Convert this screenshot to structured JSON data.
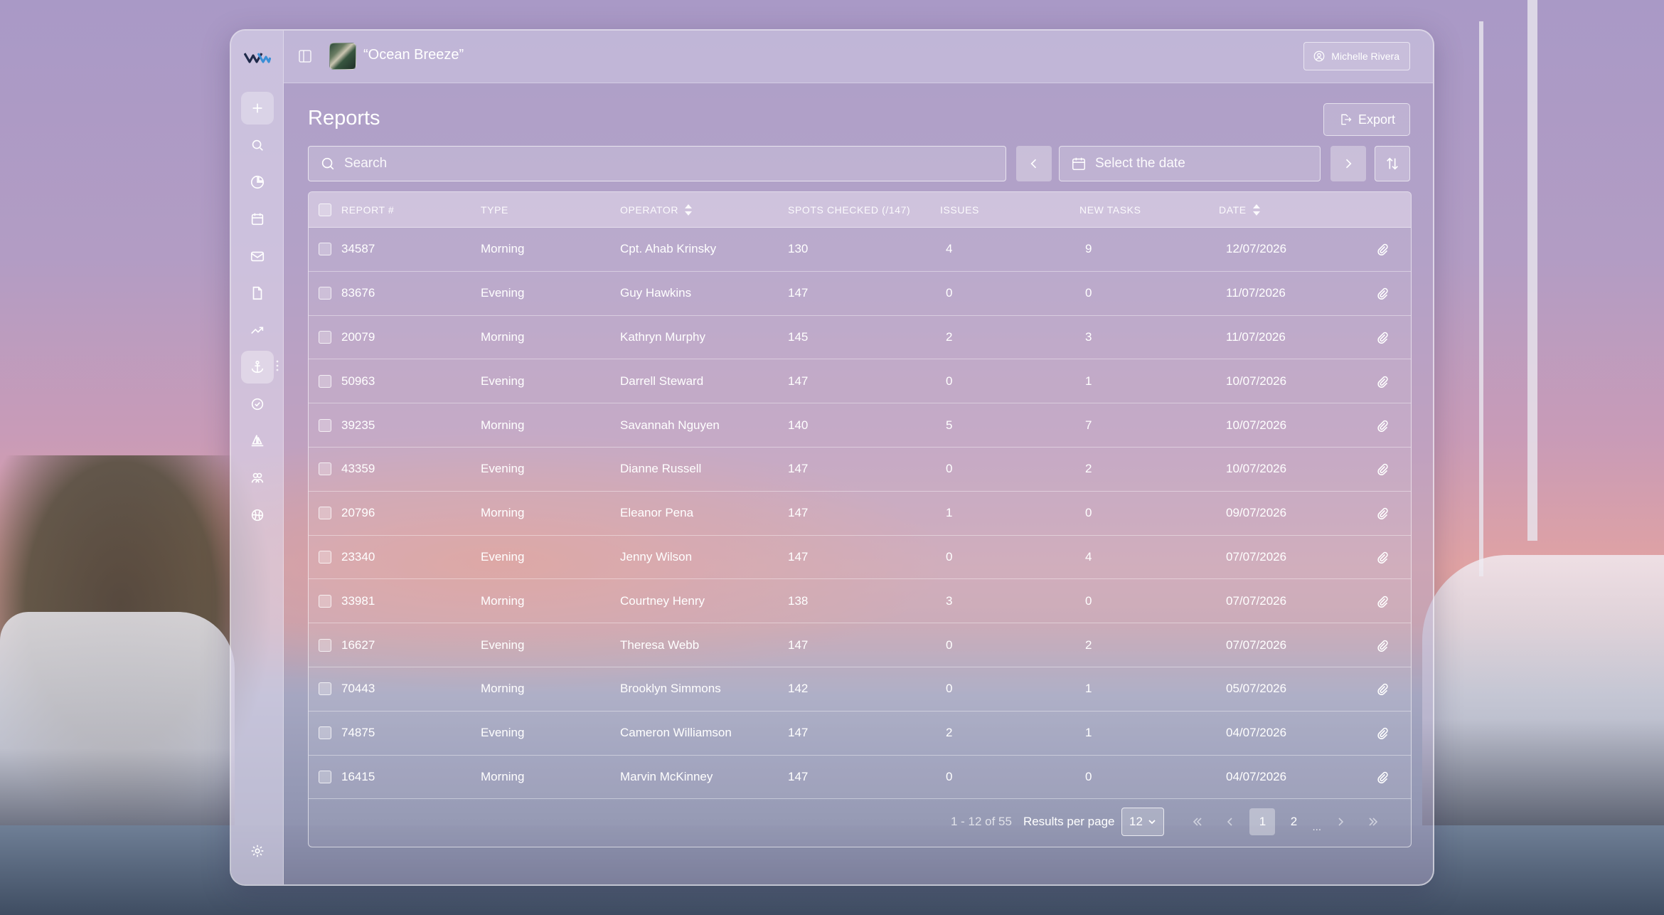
{
  "vessel": {
    "name": "“Ocean Breeze”"
  },
  "user": {
    "name": "Michelle Rivera"
  },
  "page": {
    "title": "Reports",
    "export_label": "Export"
  },
  "filters": {
    "search_placeholder": "Search",
    "date_placeholder": "Select the date"
  },
  "sidebar": {
    "items": [
      {
        "name": "add",
        "icon": "plus-icon"
      },
      {
        "name": "search",
        "icon": "search-icon"
      },
      {
        "name": "analytics",
        "icon": "pie-chart-icon"
      },
      {
        "name": "calendar",
        "icon": "calendar-icon"
      },
      {
        "name": "messages",
        "icon": "mail-icon"
      },
      {
        "name": "documents",
        "icon": "file-icon"
      },
      {
        "name": "trends",
        "icon": "trending-up-icon"
      },
      {
        "name": "reports",
        "icon": "anchor-icon",
        "active": true
      },
      {
        "name": "tasks",
        "icon": "check-circle-icon"
      },
      {
        "name": "vessels",
        "icon": "sailboat-icon"
      },
      {
        "name": "crew",
        "icon": "users-icon"
      },
      {
        "name": "globe",
        "icon": "globe-icon"
      },
      {
        "name": "settings",
        "icon": "gear-icon"
      }
    ]
  },
  "table": {
    "columns": {
      "report": "REPORT #",
      "type": "TYPE",
      "operator": "OPERATOR",
      "spots": "SPOTS CHECKED (/147)",
      "issues": "ISSUES",
      "tasks": "NEW TASKS",
      "date": "DATE"
    },
    "rows": [
      {
        "id": "34587",
        "type": "Morning",
        "operator": "Cpt. Ahab Krinsky",
        "spots": "130",
        "issues": "4",
        "tasks": "9",
        "date": "12/07/2026"
      },
      {
        "id": "83676",
        "type": "Evening",
        "operator": "Guy Hawkins",
        "spots": "147",
        "issues": "0",
        "tasks": "0",
        "date": "11/07/2026"
      },
      {
        "id": "20079",
        "type": "Morning",
        "operator": "Kathryn Murphy",
        "spots": "145",
        "issues": "2",
        "tasks": "3",
        "date": "11/07/2026"
      },
      {
        "id": "50963",
        "type": "Evening",
        "operator": "Darrell Steward",
        "spots": "147",
        "issues": "0",
        "tasks": "1",
        "date": "10/07/2026"
      },
      {
        "id": "39235",
        "type": "Morning",
        "operator": "Savannah Nguyen",
        "spots": "140",
        "issues": "5",
        "tasks": "7",
        "date": "10/07/2026"
      },
      {
        "id": "43359",
        "type": "Evening",
        "operator": "Dianne Russell",
        "spots": "147",
        "issues": "0",
        "tasks": "2",
        "date": "10/07/2026"
      },
      {
        "id": "20796",
        "type": "Morning",
        "operator": "Eleanor Pena",
        "spots": "147",
        "issues": "1",
        "tasks": "0",
        "date": "09/07/2026"
      },
      {
        "id": "23340",
        "type": "Evening",
        "operator": "Jenny Wilson",
        "spots": "147",
        "issues": "0",
        "tasks": "4",
        "date": "07/07/2026"
      },
      {
        "id": "33981",
        "type": "Morning",
        "operator": "Courtney Henry",
        "spots": "138",
        "issues": "3",
        "tasks": "0",
        "date": "07/07/2026"
      },
      {
        "id": "16627",
        "type": "Evening",
        "operator": "Theresa Webb",
        "spots": "147",
        "issues": "0",
        "tasks": "2",
        "date": "07/07/2026"
      },
      {
        "id": "70443",
        "type": "Morning",
        "operator": "Brooklyn Simmons",
        "spots": "142",
        "issues": "0",
        "tasks": "1",
        "date": "05/07/2026"
      },
      {
        "id": "74875",
        "type": "Evening",
        "operator": "Cameron Williamson",
        "spots": "147",
        "issues": "2",
        "tasks": "1",
        "date": "04/07/2026"
      },
      {
        "id": "16415",
        "type": "Morning",
        "operator": "Marvin McKinney",
        "spots": "147",
        "issues": "0",
        "tasks": "0",
        "date": "04/07/2026"
      }
    ]
  },
  "pagination": {
    "range": "1 - 12 of 55",
    "per_page_label": "Results per page",
    "per_page_value": "12",
    "pages": [
      "1",
      "2"
    ],
    "current": "1",
    "ellipsis": "..."
  }
}
